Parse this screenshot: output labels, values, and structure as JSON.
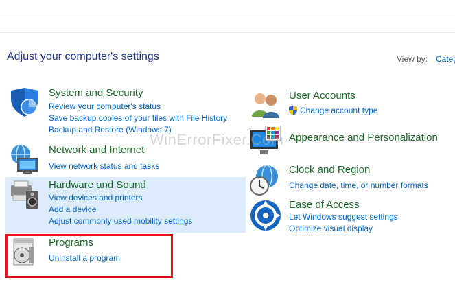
{
  "page": {
    "heading": "Adjust your computer's settings",
    "view_by_label": "View by:",
    "view_by_value": "Categ",
    "watermark": "WinErrorFixer.Com"
  },
  "categories": [
    {
      "title": "System and Security",
      "links": [
        "Review your computer's status",
        "Save backup copies of your files with File History",
        "Backup and Restore (Windows 7)"
      ],
      "icon": "shield-icon"
    },
    {
      "title": "Network and Internet",
      "links": [
        "View network status and tasks"
      ],
      "icon": "network-globe-icon"
    },
    {
      "title": "Hardware and Sound",
      "links": [
        "View devices and printers",
        "Add a device",
        "Adjust commonly used mobility settings"
      ],
      "icon": "printer-speaker-icon"
    },
    {
      "title": "Programs",
      "links": [
        "Uninstall a program"
      ],
      "icon": "programs-disc-icon"
    },
    {
      "title": "User Accounts",
      "links": [
        "Change account type"
      ],
      "icon": "users-icon"
    },
    {
      "title": "Appearance and Personalization",
      "links": [],
      "icon": "monitor-palette-icon"
    },
    {
      "title": "Clock and Region",
      "links": [
        "Change date, time, or number formats"
      ],
      "icon": "clock-globe-icon"
    },
    {
      "title": "Ease of Access",
      "links": [
        "Let Windows suggest settings",
        "Optimize visual display"
      ],
      "icon": "ease-of-access-icon"
    }
  ],
  "colors": {
    "title": "#1d6b2a",
    "link": "#0066cc",
    "heading": "#1e3287",
    "highlight": "#dcecfb",
    "annotation": "#e3141c"
  }
}
